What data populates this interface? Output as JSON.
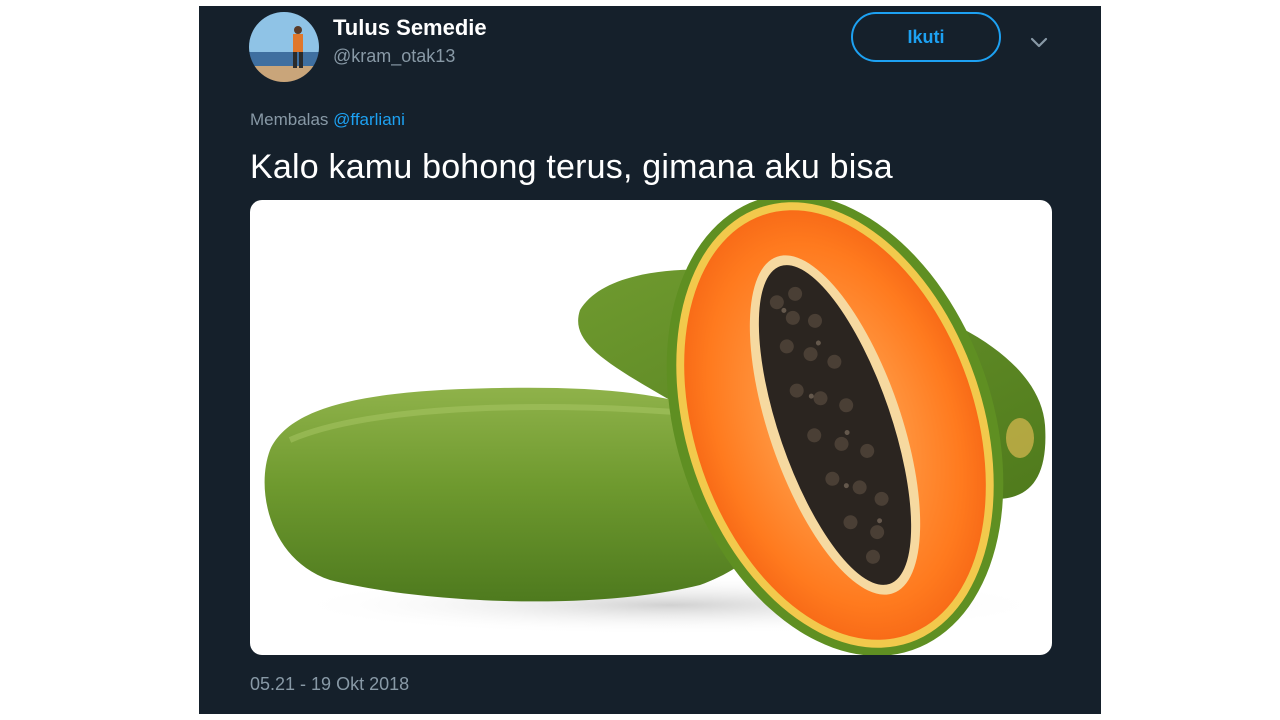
{
  "tweet": {
    "author": {
      "display_name": "Tulus Semedie",
      "handle": "@kram_otak13"
    },
    "follow_label": "Ikuti",
    "reply": {
      "prefix": "Membalas ",
      "mention": "@ffarliani"
    },
    "text": "Kalo kamu bohong terus, gimana aku bisa",
    "timestamp": "05.21 - 19 Okt 2018"
  },
  "colors": {
    "background": "#15202b",
    "accent": "#1da1f2",
    "secondary_text": "#8899a6"
  },
  "icons": {
    "more": "chevron-down-icon"
  }
}
